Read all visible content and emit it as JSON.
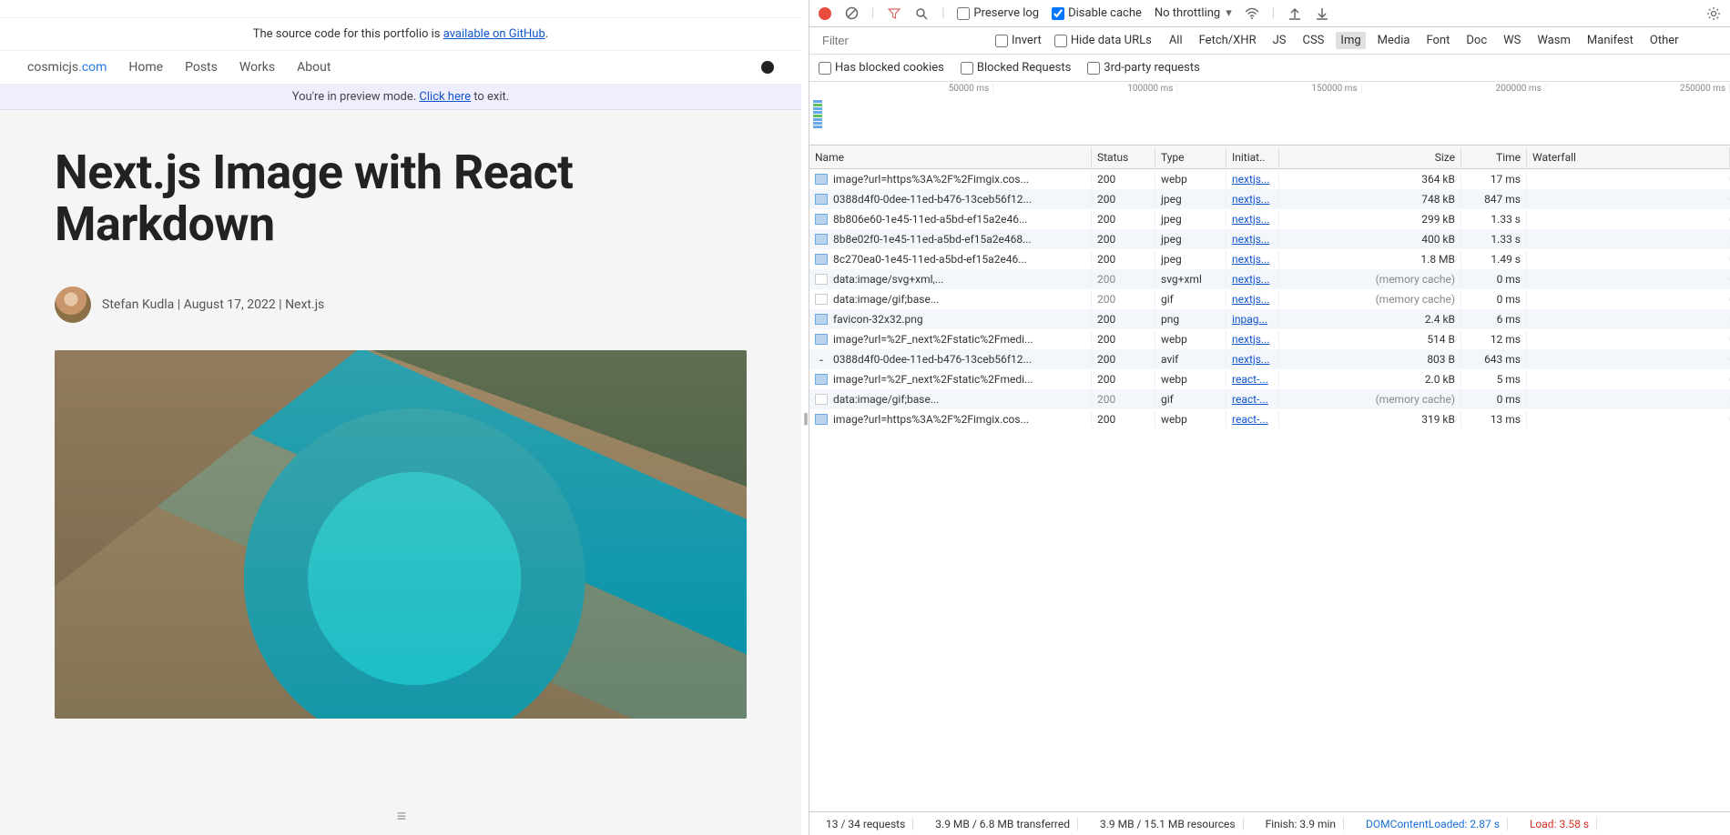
{
  "site": {
    "source_prefix": "The source code for this portfolio is ",
    "source_link": "available on GitHub",
    "source_suffix": ".",
    "brand_base": "cosmicjs",
    "brand_tld": ".com",
    "nav": {
      "home": "Home",
      "posts": "Posts",
      "works": "Works",
      "about": "About"
    },
    "preview_prefix": "You're in preview mode. ",
    "preview_link": "Click here",
    "preview_suffix": " to exit.",
    "title": "Next.js Image with React Markdown",
    "author": "Stefan Kudla",
    "breadcrumb": "August 17, 2022 | Next.js"
  },
  "devtools": {
    "preserve_log": "Preserve log",
    "disable_cache": "Disable cache",
    "throttling": "No throttling",
    "filter_placeholder": "Filter",
    "invert": "Invert",
    "hide_data_urls": "Hide data URLs",
    "has_blocked_cookies": "Has blocked cookies",
    "blocked_requests": "Blocked Requests",
    "third_party": "3rd-party requests",
    "tabs": {
      "all": "All",
      "fetch": "Fetch/XHR",
      "js": "JS",
      "css": "CSS",
      "img": "Img",
      "media": "Media",
      "font": "Font",
      "doc": "Doc",
      "ws": "WS",
      "wasm": "Wasm",
      "manifest": "Manifest",
      "other": "Other"
    },
    "timeline_ticks": [
      "50000 ms",
      "100000 ms",
      "150000 ms",
      "200000 ms",
      "250000 ms"
    ],
    "cols": {
      "name": "Name",
      "status": "Status",
      "type": "Type",
      "init": "Initiat..",
      "size": "Size",
      "time": "Time",
      "wf": "Waterfall"
    },
    "rows": [
      {
        "icon": "img",
        "name": "image?url=https%3A%2F%2Fimgix.cos...",
        "status": "200",
        "type": "webp",
        "init": "nextjs...",
        "size": "364 kB",
        "time": "17 ms",
        "mem": false
      },
      {
        "icon": "img",
        "name": "0388d4f0-0dee-11ed-b476-13ceb56f12...",
        "status": "200",
        "type": "jpeg",
        "init": "nextjs...",
        "size": "748 kB",
        "time": "847 ms",
        "mem": false
      },
      {
        "icon": "img",
        "name": "8b806e60-1e45-11ed-a5bd-ef15a2e46...",
        "status": "200",
        "type": "jpeg",
        "init": "nextjs...",
        "size": "299 kB",
        "time": "1.33 s",
        "mem": false
      },
      {
        "icon": "img",
        "name": "8b8e02f0-1e45-11ed-a5bd-ef15a2e468...",
        "status": "200",
        "type": "jpeg",
        "init": "nextjs...",
        "size": "400 kB",
        "time": "1.33 s",
        "mem": false
      },
      {
        "icon": "img",
        "name": "8c270ea0-1e45-11ed-a5bd-ef15a2e46...",
        "status": "200",
        "type": "jpeg",
        "init": "nextjs...",
        "size": "1.8 MB",
        "time": "1.49 s",
        "mem": false
      },
      {
        "icon": "blank",
        "name": "data:image/svg+xml,...",
        "status": "200",
        "type": "svg+xml",
        "init": "nextjs...",
        "size": "(memory cache)",
        "time": "0 ms",
        "mem": true
      },
      {
        "icon": "blank",
        "name": "data:image/gif;base...",
        "status": "200",
        "type": "gif",
        "init": "nextjs...",
        "size": "(memory cache)",
        "time": "0 ms",
        "mem": true
      },
      {
        "icon": "img",
        "name": "favicon-32x32.png",
        "status": "200",
        "type": "png",
        "init": "inpag...",
        "size": "2.4 kB",
        "time": "6 ms",
        "mem": false
      },
      {
        "icon": "img",
        "name": "image?url=%2F_next%2Fstatic%2Fmedi...",
        "status": "200",
        "type": "webp",
        "init": "nextjs...",
        "size": "514 B",
        "time": "12 ms",
        "mem": false
      },
      {
        "icon": "dash",
        "name": "0388d4f0-0dee-11ed-b476-13ceb56f12...",
        "status": "200",
        "type": "avif",
        "init": "nextjs...",
        "size": "803 B",
        "time": "643 ms",
        "mem": false
      },
      {
        "icon": "img",
        "name": "image?url=%2F_next%2Fstatic%2Fmedi...",
        "status": "200",
        "type": "webp",
        "init": "react-...",
        "size": "2.0 kB",
        "time": "5 ms",
        "mem": false
      },
      {
        "icon": "blank",
        "name": "data:image/gif;base...",
        "status": "200",
        "type": "gif",
        "init": "react-...",
        "size": "(memory cache)",
        "time": "0 ms",
        "mem": true
      },
      {
        "icon": "img",
        "name": "image?url=https%3A%2F%2Fimgix.cos...",
        "status": "200",
        "type": "webp",
        "init": "react-...",
        "size": "319 kB",
        "time": "13 ms",
        "mem": false
      }
    ],
    "status": {
      "requests": "13 / 34 requests",
      "transferred": "3.9 MB / 6.8 MB transferred",
      "resources": "3.9 MB / 15.1 MB resources",
      "finish": "Finish: 3.9 min",
      "dcl": "DOMContentLoaded: 2.87 s",
      "load": "Load: 3.58 s"
    }
  }
}
